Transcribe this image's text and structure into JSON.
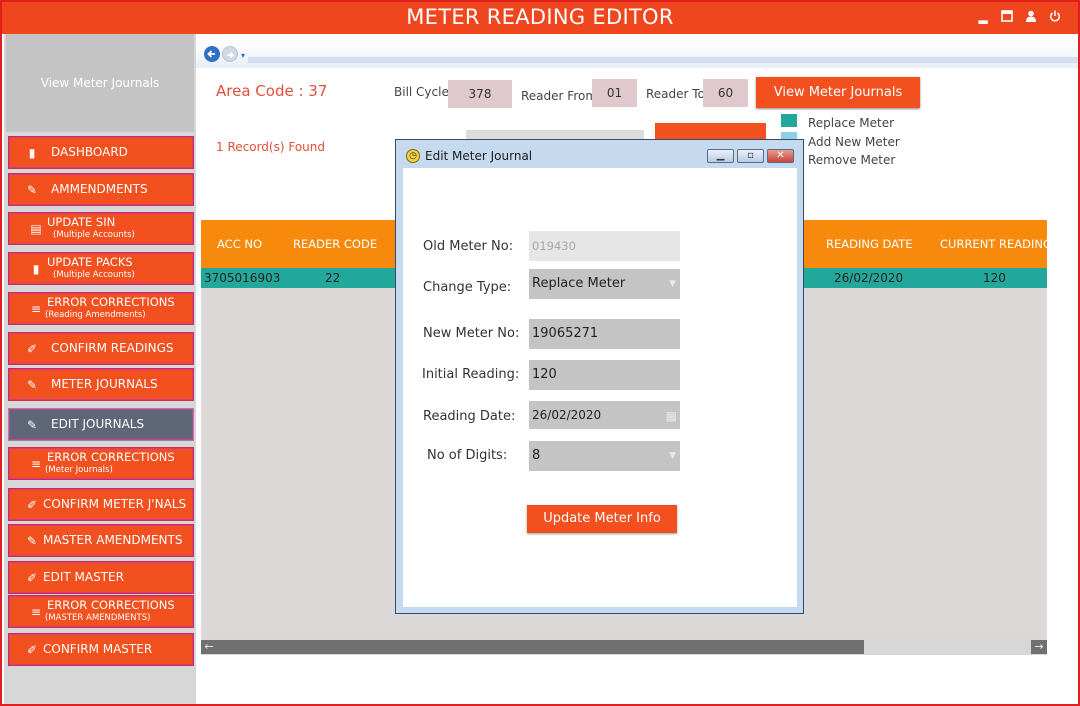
{
  "app": {
    "title": "METER READING EDITOR"
  },
  "window_controls": {
    "minimize": "▂",
    "maximize": "▣",
    "user": "👤",
    "power": "⏻"
  },
  "sidebar": {
    "header": "View Meter Journals",
    "items": [
      {
        "label": "DASHBOARD",
        "sub": "",
        "icon": "book-icon"
      },
      {
        "label": "AMMENDMENTS",
        "sub": "",
        "icon": "user-edit-icon"
      },
      {
        "label": "UPDATE SIN",
        "sub": "(Multiple Accounts)",
        "icon": "file-icon"
      },
      {
        "label": "UPDATE PACKS",
        "sub": "(Multiple Accounts)",
        "icon": "book-icon"
      },
      {
        "label": "ERROR CORRECTIONS",
        "sub": "(Reading Amendments)",
        "icon": "list-icon"
      },
      {
        "label": "CONFIRM READINGS",
        "sub": "",
        "icon": "pencil-icon"
      },
      {
        "label": "METER JOURNALS",
        "sub": "",
        "icon": "user-edit-icon"
      },
      {
        "label": "EDIT JOURNALS",
        "sub": "",
        "icon": "user-edit-icon"
      },
      {
        "label": "ERROR CORRECTIONS",
        "sub": "(Meter Journals)",
        "icon": "list-icon"
      },
      {
        "label": "CONFIRM METER J'NALS",
        "sub": "",
        "icon": "pencil-icon"
      },
      {
        "label": "MASTER AMENDMENTS",
        "sub": "",
        "icon": "user-edit-icon"
      },
      {
        "label": "EDIT MASTER",
        "sub": "",
        "icon": "pencil-icon"
      },
      {
        "label": "ERROR CORRECTIONS",
        "sub": "(MASTER AMENDMENTS)",
        "icon": "list-icon"
      },
      {
        "label": "CONFIRM MASTER",
        "sub": "",
        "icon": "pencil-icon"
      }
    ],
    "active_index": 7
  },
  "filters": {
    "area_code": "Area Code : 37",
    "bill_cycle_label": "Bill Cycle",
    "bill_cycle": "378",
    "reader_from_label": "Reader From",
    "reader_from": "01",
    "reader_to_label": "Reader To",
    "reader_to": "60",
    "view_button": "View Meter Journals",
    "records_found": "1 Record(s) Found"
  },
  "legend": [
    {
      "label": "Replace Meter",
      "color": "#22a89a"
    },
    {
      "label": "Add New Meter",
      "color": "#8ccfe8"
    },
    {
      "label": "Remove Meter",
      "color": "#ffffff"
    }
  ],
  "grid": {
    "columns": [
      "ACC NO",
      "READER CODE",
      "READING DATE",
      "CURRENT READING"
    ],
    "rows": [
      {
        "acc_no": "3705016903",
        "reader_code": "22",
        "reading_date": "26/02/2020",
        "current_reading": "120"
      }
    ]
  },
  "dialog": {
    "title": "Edit Meter Journal",
    "old_meter_label": "Old Meter No:",
    "old_meter_value": "019430",
    "change_type_label": "Change Type:",
    "change_type_value": "Replace Meter",
    "new_meter_label": "New Meter No:",
    "new_meter_value": "19065271",
    "initial_reading_label": "Initial Reading:",
    "initial_reading_value": "120",
    "reading_date_label": "Reading Date:",
    "reading_date_value": "26/02/2020",
    "digits_label": "No of Digits:",
    "digits_value": "8",
    "update_button": "Update Meter Info"
  }
}
